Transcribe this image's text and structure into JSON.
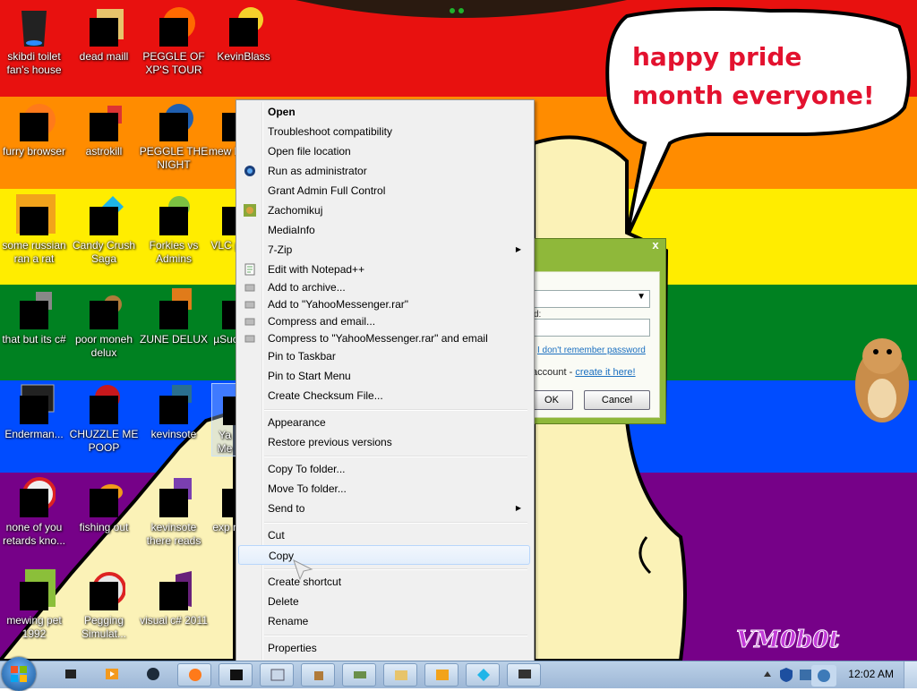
{
  "wallpaper": {
    "speech_bubble_text": "happy pride month everyone!",
    "watermark": "VM0b0t"
  },
  "desktop_icons": [
    {
      "label": "skibdi toilet fan's house"
    },
    {
      "label": "dead maill"
    },
    {
      "label": "PEGGLE OF XP'S TOUR"
    },
    {
      "label": "KevinBlass"
    },
    {
      "label": "furry browser"
    },
    {
      "label": "astrokill"
    },
    {
      "label": "PEGGLE THE NIGHT"
    },
    {
      "label": "mew le"
    },
    {
      "label": "some russian ran a rat"
    },
    {
      "label": "Candy Crush Saga"
    },
    {
      "label": "Forkies vs Admins"
    },
    {
      "label": "VLC p"
    },
    {
      "label": "that but its c#"
    },
    {
      "label": "poor moneh delux"
    },
    {
      "label": "ZUNE DELUX"
    },
    {
      "label": "µSuc"
    },
    {
      "label": "Enderman..."
    },
    {
      "label": "CHUZZLE ME POOP"
    },
    {
      "label": "kevinsote"
    },
    {
      "label": "Ya Me"
    },
    {
      "label": "none of you retards kno..."
    },
    {
      "label": "fishing out"
    },
    {
      "label": "kevinsote there reads"
    },
    {
      "label": "exp n"
    },
    {
      "label": "mewing pet 1992"
    },
    {
      "label": "Pegging Simulat..."
    },
    {
      "label": "visual c# 2011"
    }
  ],
  "login_dialog": {
    "close": "x",
    "password_label": "d:",
    "forgot_link": "I don't remember password",
    "account_text": "account -",
    "create_link": "create it here!",
    "ok_button": "OK",
    "cancel_button": "Cancel"
  },
  "context_menu": {
    "items": [
      {
        "label": "Open"
      },
      {
        "label": "Troubleshoot compatibility"
      },
      {
        "label": "Open file location"
      },
      {
        "label": "Run as administrator"
      },
      {
        "label": "Grant Admin Full Control"
      },
      {
        "label": "Zachomikuj"
      },
      {
        "label": "MediaInfo"
      },
      {
        "label": "7-Zip"
      },
      {
        "label": "Edit with Notepad++"
      },
      {
        "label": "Add to archive..."
      },
      {
        "label": "Add to \"YahooMessenger.rar\""
      },
      {
        "label": "Compress and email..."
      },
      {
        "label": "Compress to \"YahooMessenger.rar\" and email"
      },
      {
        "label": "Pin to Taskbar"
      },
      {
        "label": "Pin to Start Menu"
      },
      {
        "label": "Create Checksum File..."
      },
      {
        "label": "Appearance"
      },
      {
        "label": "Restore previous versions"
      },
      {
        "label": "Copy To folder..."
      },
      {
        "label": "Move To folder..."
      },
      {
        "label": "Send to"
      },
      {
        "label": "Cut"
      },
      {
        "label": "Copy"
      },
      {
        "label": "Create shortcut"
      },
      {
        "label": "Delete"
      },
      {
        "label": "Rename"
      },
      {
        "label": "Properties"
      }
    ]
  },
  "taskbar": {
    "clock": "12:02 AM"
  },
  "colors": {
    "speech_text": "#e3122f",
    "menu_highlight": "#e3eefb",
    "taskbar": "#b5cbe3"
  }
}
